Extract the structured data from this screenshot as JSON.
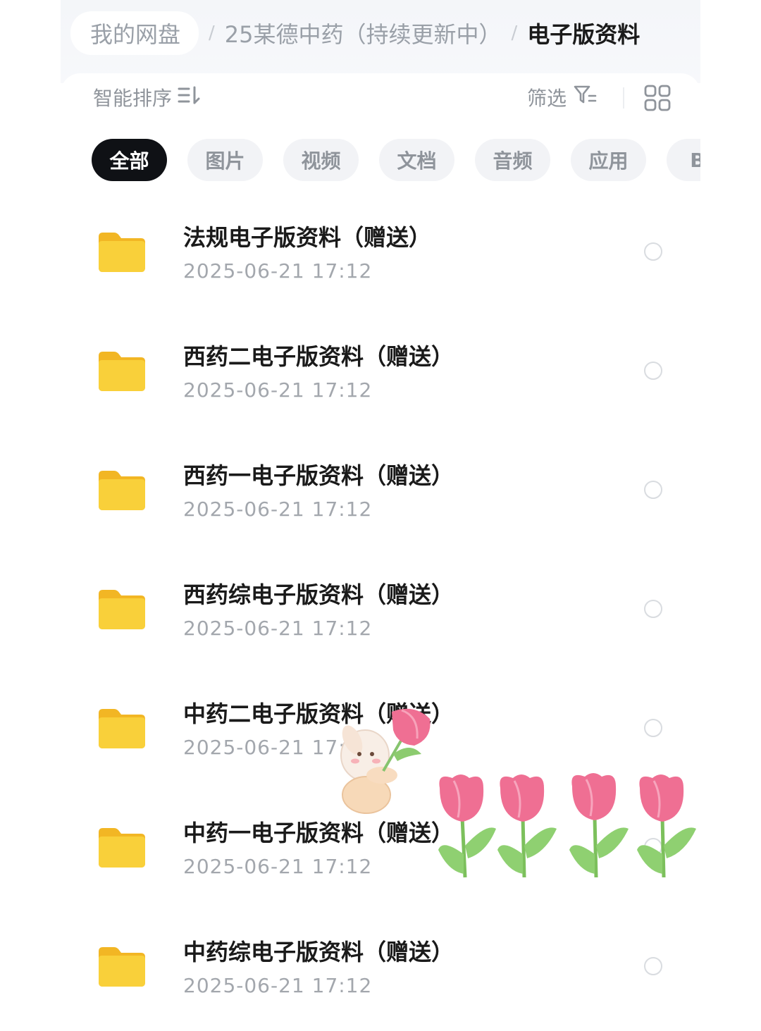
{
  "breadcrumb": {
    "root": "我的网盘",
    "separator": "/",
    "middle": "25某德中药（持续更新中）",
    "current": "电子版资料"
  },
  "toolbar": {
    "sort_label": "智能排序",
    "sort_icon": "sort-icon",
    "filter_label": "筛选",
    "filter_icon": "filter-icon",
    "view_icon": "grid-view-icon"
  },
  "categories": [
    {
      "label": "全部",
      "active": true
    },
    {
      "label": "图片",
      "active": false
    },
    {
      "label": "视频",
      "active": false
    },
    {
      "label": "文档",
      "active": false
    },
    {
      "label": "音频",
      "active": false
    },
    {
      "label": "应用",
      "active": false
    },
    {
      "label": "BT",
      "active": false
    }
  ],
  "files": [
    {
      "name": "法规电子版资料（赠送）",
      "date": "2025-06-21  17:12",
      "icon": "folder-icon"
    },
    {
      "name": "西药二电子版资料（赠送）",
      "date": "2025-06-21  17:12",
      "icon": "folder-icon"
    },
    {
      "name": "西药一电子版资料（赠送）",
      "date": "2025-06-21  17:12",
      "icon": "folder-icon"
    },
    {
      "name": "西药综电子版资料（赠送）",
      "date": "2025-06-21  17:12",
      "icon": "folder-icon"
    },
    {
      "name": "中药二电子版资料（赠送）",
      "date": "2025-06-21  17:12",
      "icon": "folder-icon"
    },
    {
      "name": "中药一电子版资料（赠送）",
      "date": "2025-06-21  17:12",
      "icon": "folder-icon"
    },
    {
      "name": "中药综电子版资料（赠送）",
      "date": "2025-06-21  17:12",
      "icon": "folder-icon"
    }
  ],
  "colors": {
    "folder": "#f7c531",
    "active_chip": "#0f1115",
    "tulip": "#ef6f93"
  },
  "decoration": {
    "sticker": "tulip-and-bunny-sticker"
  }
}
